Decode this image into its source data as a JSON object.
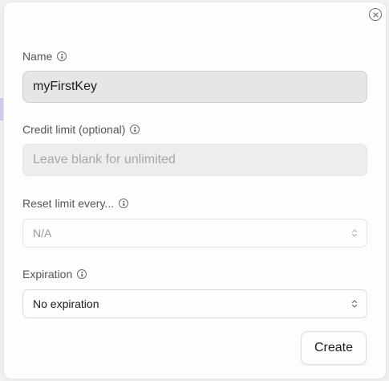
{
  "dialog": {
    "close_icon": "close-circle-icon",
    "fields": {
      "name": {
        "label": "Name",
        "value": "myFirstKey"
      },
      "credit_limit": {
        "label": "Credit limit (optional)",
        "placeholder": "Leave blank for unlimited"
      },
      "reset_limit": {
        "label": "Reset limit every...",
        "value": "N/A"
      },
      "expiration": {
        "label": "Expiration",
        "value": "No expiration"
      }
    },
    "create_label": "Create"
  }
}
